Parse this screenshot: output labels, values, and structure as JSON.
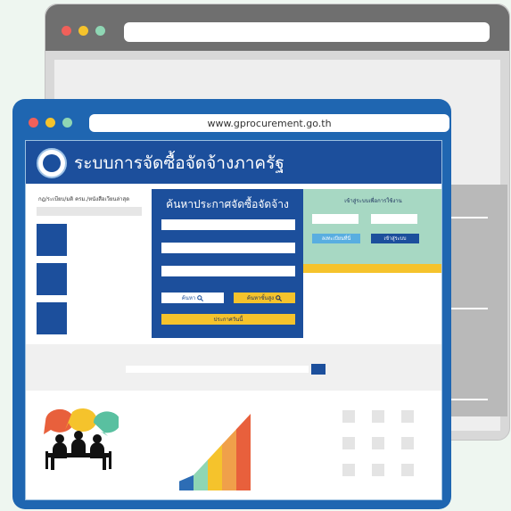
{
  "colors": {
    "dot_red": "#f0605a",
    "dot_yellow": "#f5c32c",
    "dot_green": "#8fd6b4",
    "navy": "#1c4f9c",
    "frame_blue": "#1f66b1",
    "accent_yellow": "#f5c32c",
    "mint": "#a7d8c3"
  },
  "browser": {
    "url": "www.gprocurement.go.th"
  },
  "site": {
    "title": "ระบบการจัดซื้อจัดจ้างภาครัฐ",
    "logo_icon": "government-emblem-icon"
  },
  "left_column": {
    "heading": "กฎ/ระเบียบ/มติ ครม./หนังสือเวียนล่าสุด"
  },
  "search_panel": {
    "title": "ค้นหาประกาศจัดซื้อจัดจ้าง",
    "search_button": "ค้นหา",
    "advanced_search_button": "ค้นหาขั้นสูง",
    "today_button": "ประกาศวันนี้"
  },
  "login_panel": {
    "title": "เข้าสู่ระบบเพื่อการใช้งาน",
    "register_button": "ลงทะเบียนที่นี่",
    "login_button": "เข้าสู่ระบบ"
  },
  "chart_data": {
    "type": "bar",
    "values": [
      1,
      2,
      3,
      4,
      5
    ],
    "colors": [
      "#2d6db5",
      "#8fd6b4",
      "#f5c32c",
      "#f0a04a",
      "#e8603c"
    ]
  }
}
